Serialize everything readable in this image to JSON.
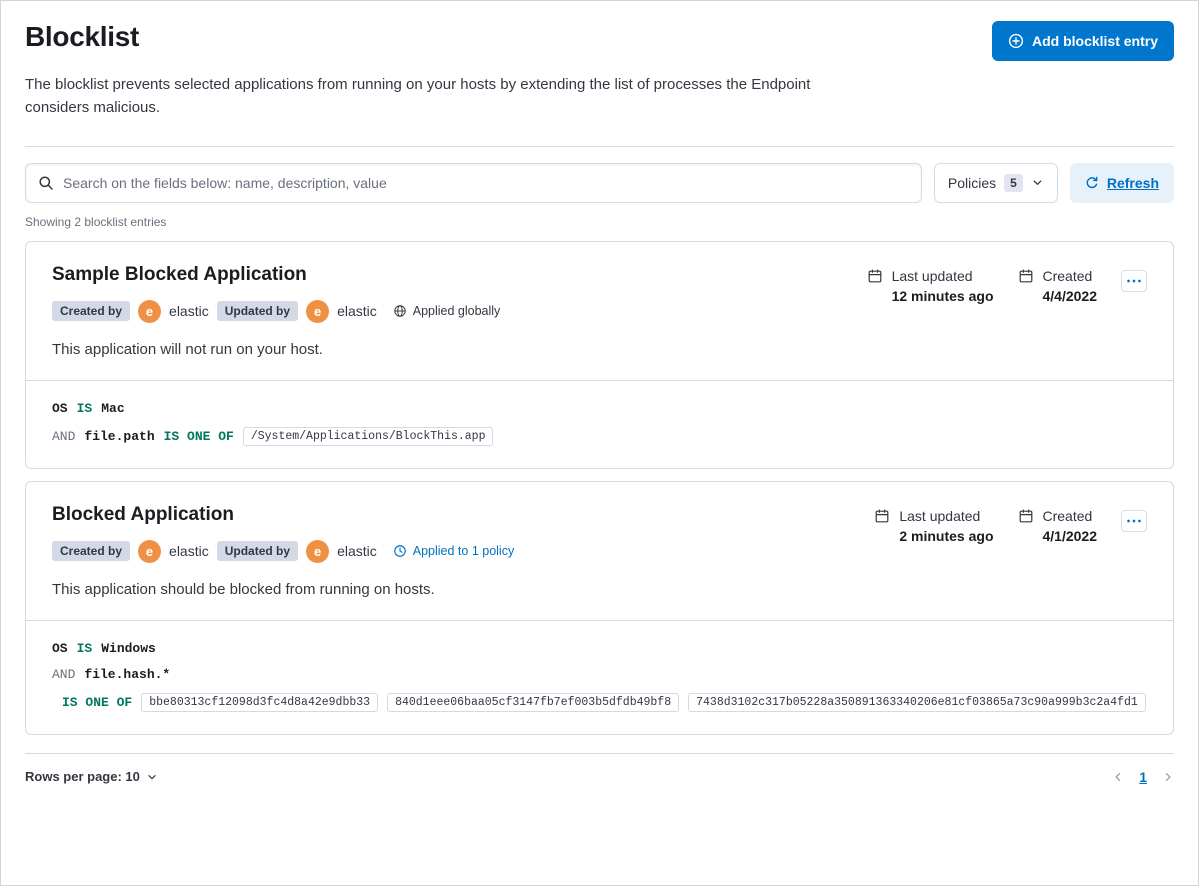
{
  "page": {
    "title": "Blocklist",
    "description": "The blocklist prevents selected applications from running on your hosts by extending the list of processes the Endpoint considers malicious.",
    "add_button_label": "Add blocklist entry",
    "showing_text": "Showing 2 blocklist entries"
  },
  "toolbar": {
    "search_placeholder": "Search on the fields below: name, description, value",
    "policies_label": "Policies",
    "policies_count": "5",
    "refresh_label": "Refresh"
  },
  "entries": [
    {
      "title": "Sample Blocked Application",
      "created_by": {
        "label": "Created by",
        "initial": "e",
        "name": "elastic"
      },
      "updated_by": {
        "label": "Updated by",
        "initial": "e",
        "name": "elastic"
      },
      "scope": {
        "label": "Applied globally",
        "type": "global"
      },
      "meta": {
        "last_updated_label": "Last updated",
        "last_updated_value": "12 minutes ago",
        "created_label": "Created",
        "created_value": "4/4/2022"
      },
      "description": "This application will not run on your host.",
      "criteria": {
        "os": {
          "field": "OS",
          "operator": "IS",
          "value": "Mac"
        },
        "condition": {
          "conjunction": "AND",
          "field": "file.path",
          "operator": "IS ONE OF",
          "values": [
            "/System/Applications/BlockThis.app"
          ]
        }
      }
    },
    {
      "title": "Blocked Application",
      "created_by": {
        "label": "Created by",
        "initial": "e",
        "name": "elastic"
      },
      "updated_by": {
        "label": "Updated by",
        "initial": "e",
        "name": "elastic"
      },
      "scope": {
        "label": "Applied to 1 policy",
        "type": "policy"
      },
      "meta": {
        "last_updated_label": "Last updated",
        "last_updated_value": "2 minutes ago",
        "created_label": "Created",
        "created_value": "4/1/2022"
      },
      "description": "This application should be blocked from running on hosts.",
      "criteria": {
        "os": {
          "field": "OS",
          "operator": "IS",
          "value": "Windows"
        },
        "condition": {
          "conjunction": "AND",
          "field": "file.hash.*",
          "operator": "IS ONE OF",
          "values": [
            "bbe80313cf12098d3fc4d8a42e9dbb33",
            "840d1eee06baa05cf3147fb7ef003b5dfdb49bf8",
            "7438d3102c317b05228a350891363340206e81cf03865a73c90a999b3c2a4fd1"
          ]
        }
      }
    }
  ],
  "footer": {
    "rows_per_page_label": "Rows per page: 10",
    "page_number": "1"
  },
  "icons": {
    "add_entry": "plus-in-circle",
    "search": "magnifier",
    "policies_dropdown": "chevron-down",
    "refresh": "refresh-arrow",
    "date": "calendar",
    "global_scope": "globe",
    "policy_scope": "clock",
    "entry_actions": "three-dots",
    "rows_dropdown": "chevron-down",
    "page_prev": "chevron-left",
    "page_next": "chevron-right"
  },
  "colors": {
    "primary_button": "#0077cc",
    "link": "#0071c2",
    "refresh_button_bg": "#e6f1fa",
    "badge_bg": "#d3dae6",
    "avatar_bg": "#ef9144",
    "operator_text": "#00785e",
    "border": "#d3dae6",
    "subdued_text": "#69707d"
  }
}
